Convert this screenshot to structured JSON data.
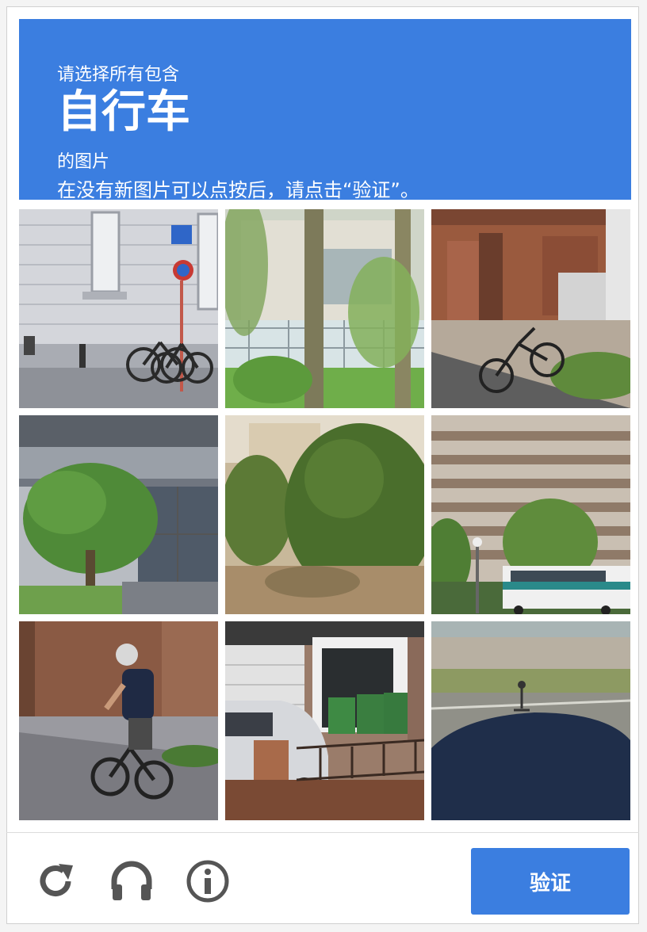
{
  "header": {
    "prompt_prefix": "请选择所有包含",
    "keyword": "自行车",
    "prompt_suffix": "的图片",
    "instruction": "在没有新图片可以点按后，请点击“验证”。"
  },
  "grid": {
    "tiles": [
      {
        "name": "tile-1",
        "description_icon": "street-bicycles-image"
      },
      {
        "name": "tile-2",
        "description_icon": "trees-fence-image"
      },
      {
        "name": "tile-3",
        "description_icon": "brick-house-bicycle-image"
      },
      {
        "name": "tile-4",
        "description_icon": "building-tree-image"
      },
      {
        "name": "tile-5",
        "description_icon": "bushes-image"
      },
      {
        "name": "tile-6",
        "description_icon": "apartment-bus-image"
      },
      {
        "name": "tile-7",
        "description_icon": "cyclist-image"
      },
      {
        "name": "tile-8",
        "description_icon": "garage-bins-image"
      },
      {
        "name": "tile-9",
        "description_icon": "road-shadow-image"
      }
    ]
  },
  "footer": {
    "reload_icon": "reload-icon",
    "audio_icon": "headphones-icon",
    "info_icon": "info-icon",
    "verify_label": "验证"
  },
  "colors": {
    "accent": "#3b7ee0",
    "icon_gray": "#555555"
  }
}
